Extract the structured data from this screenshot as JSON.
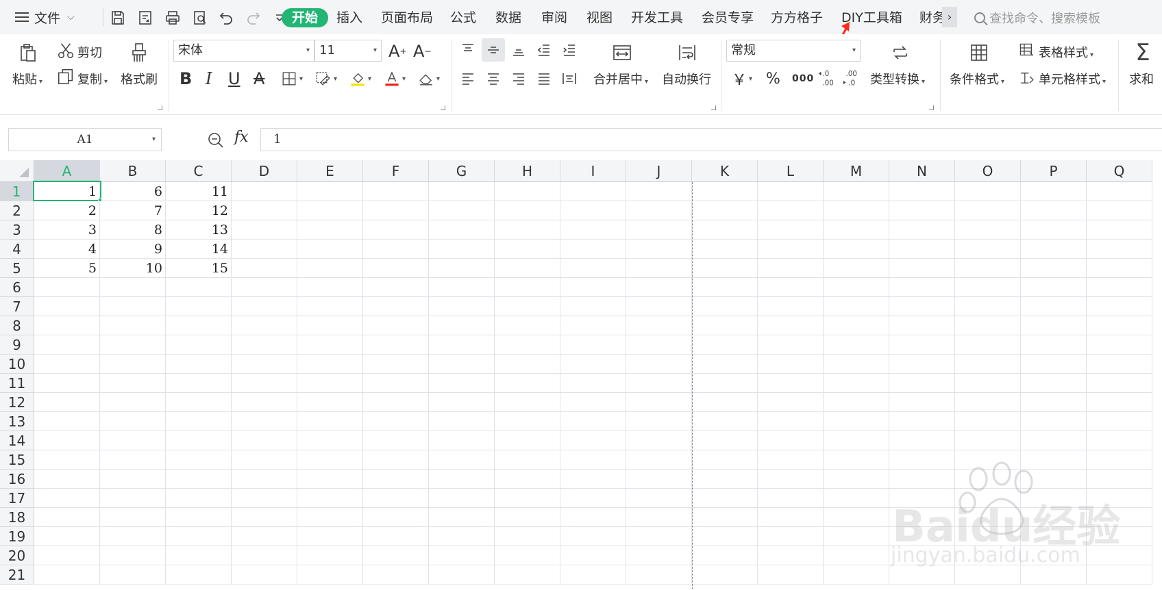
{
  "menubar": {
    "file_label": "文件",
    "tabs": [
      "开始",
      "插入",
      "页面布局",
      "公式",
      "数据",
      "审阅",
      "视图",
      "开发工具",
      "会员专享",
      "方方格子",
      "DIY工具箱",
      "财务"
    ],
    "active_tab": "开始",
    "more_label": "›",
    "search_placeholder": "查找命令、搜索模板"
  },
  "ribbon": {
    "clipboard": {
      "paste": "粘贴",
      "cut": "剪切",
      "copy": "复制",
      "format_painter": "格式刷"
    },
    "font": {
      "name": "宋体",
      "size": "11"
    },
    "alignment": {
      "merge_center": "合并居中",
      "wrap_text": "自动换行"
    },
    "number": {
      "format": "常规",
      "currency": "￥",
      "percent": "%",
      "thousands": "000",
      "type_convert": "类型转换"
    },
    "styles": {
      "conditional": "条件格式",
      "table_style": "表格样式",
      "cell_style": "单元格样式"
    },
    "editing": {
      "sum": "求和"
    }
  },
  "formula_bar": {
    "name_box": "A1",
    "fx": "fx",
    "value": "1"
  },
  "grid": {
    "columns": [
      "A",
      "B",
      "C",
      "D",
      "E",
      "F",
      "G",
      "H",
      "I",
      "J",
      "K",
      "L",
      "M",
      "N",
      "O",
      "P",
      "Q"
    ],
    "rows": [
      "1",
      "2",
      "3",
      "4",
      "5",
      "6",
      "7",
      "8",
      "9",
      "10",
      "11",
      "12",
      "13",
      "14",
      "15",
      "16",
      "17",
      "18",
      "19",
      "20",
      "21"
    ],
    "cells": [
      [
        "1",
        "6",
        "11"
      ],
      [
        "2",
        "7",
        "12"
      ],
      [
        "3",
        "8",
        "13"
      ],
      [
        "4",
        "9",
        "14"
      ],
      [
        "5",
        "10",
        "15"
      ]
    ],
    "selected_column": "A",
    "selected_row": "1"
  },
  "watermark": {
    "brand": "Baidu经验",
    "url": "jingyan.baidu.com"
  },
  "colors": {
    "accent": "#22b573",
    "arrow": "#ff2a1a"
  }
}
